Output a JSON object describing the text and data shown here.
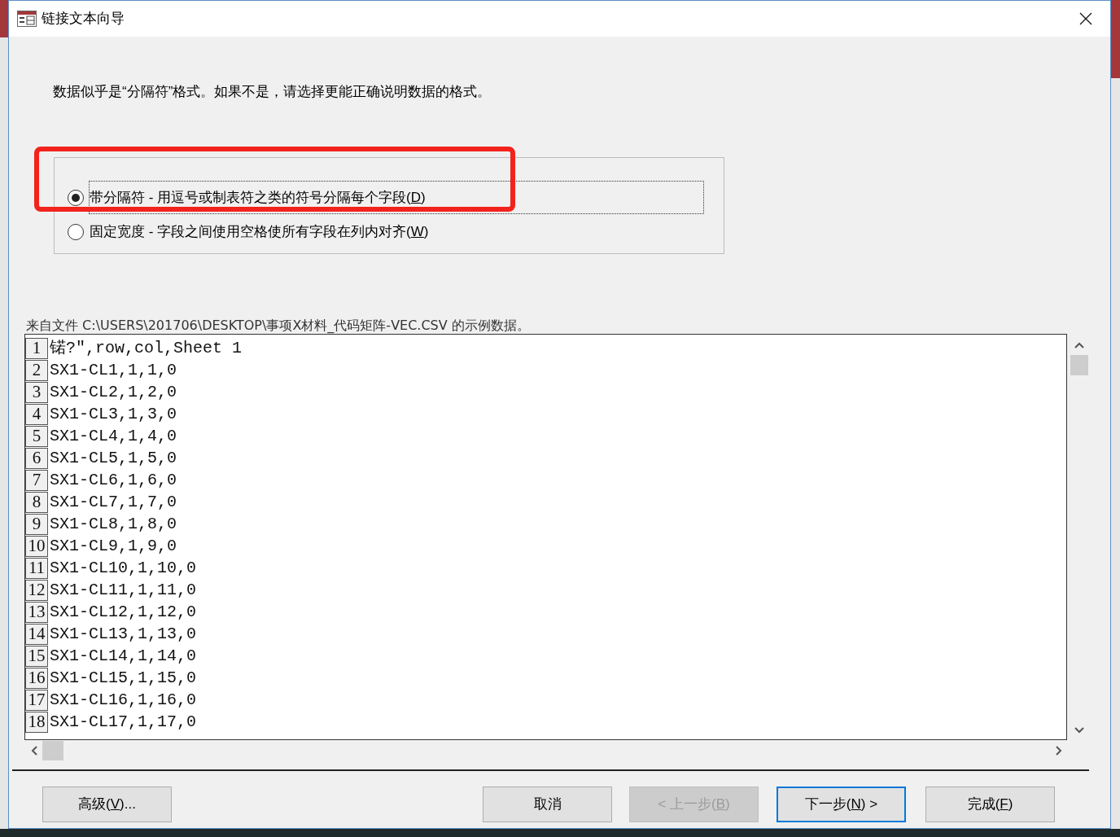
{
  "window": {
    "title": "链接文本向导"
  },
  "instruction": "数据似乎是“分隔符”格式。如果不是，请选择更能正确说明数据的格式。",
  "format_options": [
    {
      "before": "带分隔符 - 用逗号或制表符之类的符号分隔每个字段(",
      "key": "D",
      "after": ")",
      "selected": true,
      "focused": true
    },
    {
      "before": "固定宽度 - 字段之间使用空格使所有字段在列内对齐(",
      "key": "W",
      "after": ")",
      "selected": false,
      "focused": false
    }
  ],
  "sample": {
    "label": "来自文件 C:\\USERS\\201706\\DESKTOP\\事项X材料_代码矩阵-VEC.CSV 的示例数据。",
    "rows": [
      {
        "number": "1",
        "text": "锘?″,row,col,Sheet 1"
      },
      {
        "number": "2",
        "text": "SX1-CL1,1,1,0"
      },
      {
        "number": "3",
        "text": "SX1-CL2,1,2,0"
      },
      {
        "number": "4",
        "text": "SX1-CL3,1,3,0"
      },
      {
        "number": "5",
        "text": "SX1-CL4,1,4,0"
      },
      {
        "number": "6",
        "text": "SX1-CL5,1,5,0"
      },
      {
        "number": "7",
        "text": "SX1-CL6,1,6,0"
      },
      {
        "number": "8",
        "text": "SX1-CL7,1,7,0"
      },
      {
        "number": "9",
        "text": "SX1-CL8,1,8,0"
      },
      {
        "number": "10",
        "text": "SX1-CL9,1,9,0"
      },
      {
        "number": "11",
        "text": "SX1-CL10,1,10,0"
      },
      {
        "number": "12",
        "text": "SX1-CL11,1,11,0"
      },
      {
        "number": "13",
        "text": "SX1-CL12,1,12,0"
      },
      {
        "number": "14",
        "text": "SX1-CL13,1,13,0"
      },
      {
        "number": "15",
        "text": "SX1-CL14,1,14,0"
      },
      {
        "number": "16",
        "text": "SX1-CL15,1,15,0"
      },
      {
        "number": "17",
        "text": "SX1-CL16,1,16,0"
      },
      {
        "number": "18",
        "text": "SX1-CL17,1,17,0"
      }
    ]
  },
  "buttons": [
    {
      "before": "高级(",
      "key": "V",
      "after": ")...",
      "disabled": false,
      "focused": false
    },
    {
      "before": "取消",
      "disabled": false,
      "focused": false
    },
    {
      "before": "< 上一步(",
      "key": "B",
      "after": ")",
      "disabled": true,
      "focused": false
    },
    {
      "before": "下一步(",
      "key": "N",
      "after": ") >",
      "disabled": false,
      "focused": true
    },
    {
      "before": "完成(",
      "key": "F",
      "after": ")",
      "disabled": false,
      "focused": false
    }
  ]
}
